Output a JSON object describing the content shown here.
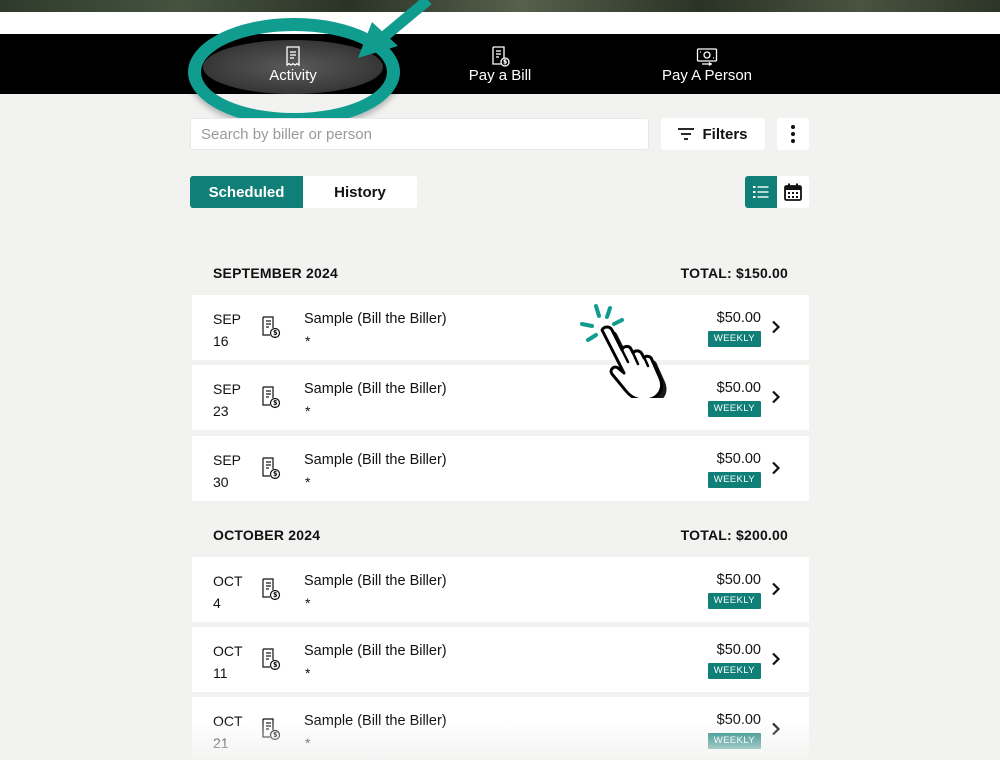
{
  "nav": {
    "items": [
      {
        "label": "Activity",
        "icon": "receipt-icon"
      },
      {
        "label": "Pay a Bill",
        "icon": "bill-dollar-icon"
      },
      {
        "label": "Pay A Person",
        "icon": "money-transfer-icon"
      }
    ]
  },
  "search": {
    "placeholder": "Search by biller or person"
  },
  "toolbar": {
    "filters_label": "Filters"
  },
  "tabs": [
    {
      "label": "Scheduled",
      "active": true
    },
    {
      "label": "History",
      "active": false
    }
  ],
  "colors": {
    "accent": "#0f7f77",
    "annotation": "#119c90",
    "navbar": "#000000",
    "background": "#f2f2f1"
  },
  "months": [
    {
      "title": "SEPTEMBER 2024",
      "total": "TOTAL: $150.00",
      "payments": [
        {
          "mon": "SEP",
          "day": "16",
          "payee": "Sample (Bill the Biller)",
          "note": "*",
          "amount": "$50.00",
          "frequency": "WEEKLY"
        },
        {
          "mon": "SEP",
          "day": "23",
          "payee": "Sample (Bill the Biller)",
          "note": "*",
          "amount": "$50.00",
          "frequency": "WEEKLY"
        },
        {
          "mon": "SEP",
          "day": "30",
          "payee": "Sample (Bill the Biller)",
          "note": "*",
          "amount": "$50.00",
          "frequency": "WEEKLY"
        }
      ]
    },
    {
      "title": "OCTOBER 2024",
      "total": "TOTAL: $200.00",
      "payments": [
        {
          "mon": "OCT",
          "day": "4",
          "payee": "Sample (Bill the Biller)",
          "note": "*",
          "amount": "$50.00",
          "frequency": "WEEKLY"
        },
        {
          "mon": "OCT",
          "day": "11",
          "payee": "Sample (Bill the Biller)",
          "note": "*",
          "amount": "$50.00",
          "frequency": "WEEKLY"
        },
        {
          "mon": "OCT",
          "day": "21",
          "payee": "Sample (Bill the Biller)",
          "note": "*",
          "amount": "$50.00",
          "frequency": "WEEKLY"
        }
      ]
    }
  ]
}
